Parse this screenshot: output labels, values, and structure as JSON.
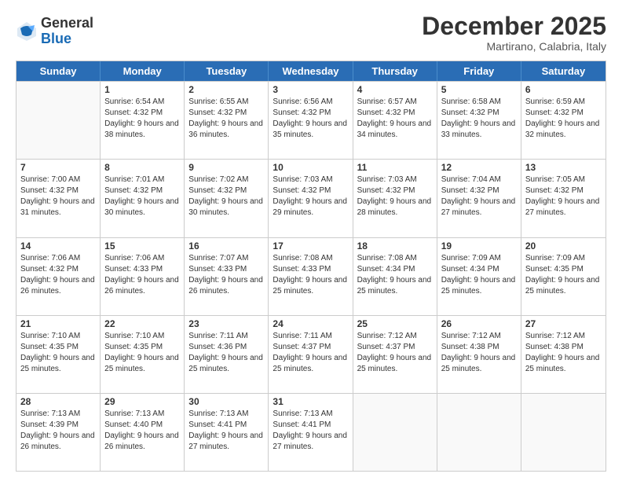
{
  "logo": {
    "general": "General",
    "blue": "Blue"
  },
  "header": {
    "title": "December 2025",
    "location": "Martirano, Calabria, Italy"
  },
  "days_of_week": [
    "Sunday",
    "Monday",
    "Tuesday",
    "Wednesday",
    "Thursday",
    "Friday",
    "Saturday"
  ],
  "weeks": [
    [
      {
        "day": "",
        "empty": true
      },
      {
        "day": "1",
        "sunrise": "Sunrise: 6:54 AM",
        "sunset": "Sunset: 4:32 PM",
        "daylight": "Daylight: 9 hours and 38 minutes."
      },
      {
        "day": "2",
        "sunrise": "Sunrise: 6:55 AM",
        "sunset": "Sunset: 4:32 PM",
        "daylight": "Daylight: 9 hours and 36 minutes."
      },
      {
        "day": "3",
        "sunrise": "Sunrise: 6:56 AM",
        "sunset": "Sunset: 4:32 PM",
        "daylight": "Daylight: 9 hours and 35 minutes."
      },
      {
        "day": "4",
        "sunrise": "Sunrise: 6:57 AM",
        "sunset": "Sunset: 4:32 PM",
        "daylight": "Daylight: 9 hours and 34 minutes."
      },
      {
        "day": "5",
        "sunrise": "Sunrise: 6:58 AM",
        "sunset": "Sunset: 4:32 PM",
        "daylight": "Daylight: 9 hours and 33 minutes."
      },
      {
        "day": "6",
        "sunrise": "Sunrise: 6:59 AM",
        "sunset": "Sunset: 4:32 PM",
        "daylight": "Daylight: 9 hours and 32 minutes."
      }
    ],
    [
      {
        "day": "7",
        "sunrise": "Sunrise: 7:00 AM",
        "sunset": "Sunset: 4:32 PM",
        "daylight": "Daylight: 9 hours and 31 minutes."
      },
      {
        "day": "8",
        "sunrise": "Sunrise: 7:01 AM",
        "sunset": "Sunset: 4:32 PM",
        "daylight": "Daylight: 9 hours and 30 minutes."
      },
      {
        "day": "9",
        "sunrise": "Sunrise: 7:02 AM",
        "sunset": "Sunset: 4:32 PM",
        "daylight": "Daylight: 9 hours and 30 minutes."
      },
      {
        "day": "10",
        "sunrise": "Sunrise: 7:03 AM",
        "sunset": "Sunset: 4:32 PM",
        "daylight": "Daylight: 9 hours and 29 minutes."
      },
      {
        "day": "11",
        "sunrise": "Sunrise: 7:03 AM",
        "sunset": "Sunset: 4:32 PM",
        "daylight": "Daylight: 9 hours and 28 minutes."
      },
      {
        "day": "12",
        "sunrise": "Sunrise: 7:04 AM",
        "sunset": "Sunset: 4:32 PM",
        "daylight": "Daylight: 9 hours and 27 minutes."
      },
      {
        "day": "13",
        "sunrise": "Sunrise: 7:05 AM",
        "sunset": "Sunset: 4:32 PM",
        "daylight": "Daylight: 9 hours and 27 minutes."
      }
    ],
    [
      {
        "day": "14",
        "sunrise": "Sunrise: 7:06 AM",
        "sunset": "Sunset: 4:32 PM",
        "daylight": "Daylight: 9 hours and 26 minutes."
      },
      {
        "day": "15",
        "sunrise": "Sunrise: 7:06 AM",
        "sunset": "Sunset: 4:33 PM",
        "daylight": "Daylight: 9 hours and 26 minutes."
      },
      {
        "day": "16",
        "sunrise": "Sunrise: 7:07 AM",
        "sunset": "Sunset: 4:33 PM",
        "daylight": "Daylight: 9 hours and 26 minutes."
      },
      {
        "day": "17",
        "sunrise": "Sunrise: 7:08 AM",
        "sunset": "Sunset: 4:33 PM",
        "daylight": "Daylight: 9 hours and 25 minutes."
      },
      {
        "day": "18",
        "sunrise": "Sunrise: 7:08 AM",
        "sunset": "Sunset: 4:34 PM",
        "daylight": "Daylight: 9 hours and 25 minutes."
      },
      {
        "day": "19",
        "sunrise": "Sunrise: 7:09 AM",
        "sunset": "Sunset: 4:34 PM",
        "daylight": "Daylight: 9 hours and 25 minutes."
      },
      {
        "day": "20",
        "sunrise": "Sunrise: 7:09 AM",
        "sunset": "Sunset: 4:35 PM",
        "daylight": "Daylight: 9 hours and 25 minutes."
      }
    ],
    [
      {
        "day": "21",
        "sunrise": "Sunrise: 7:10 AM",
        "sunset": "Sunset: 4:35 PM",
        "daylight": "Daylight: 9 hours and 25 minutes."
      },
      {
        "day": "22",
        "sunrise": "Sunrise: 7:10 AM",
        "sunset": "Sunset: 4:35 PM",
        "daylight": "Daylight: 9 hours and 25 minutes."
      },
      {
        "day": "23",
        "sunrise": "Sunrise: 7:11 AM",
        "sunset": "Sunset: 4:36 PM",
        "daylight": "Daylight: 9 hours and 25 minutes."
      },
      {
        "day": "24",
        "sunrise": "Sunrise: 7:11 AM",
        "sunset": "Sunset: 4:37 PM",
        "daylight": "Daylight: 9 hours and 25 minutes."
      },
      {
        "day": "25",
        "sunrise": "Sunrise: 7:12 AM",
        "sunset": "Sunset: 4:37 PM",
        "daylight": "Daylight: 9 hours and 25 minutes."
      },
      {
        "day": "26",
        "sunrise": "Sunrise: 7:12 AM",
        "sunset": "Sunset: 4:38 PM",
        "daylight": "Daylight: 9 hours and 25 minutes."
      },
      {
        "day": "27",
        "sunrise": "Sunrise: 7:12 AM",
        "sunset": "Sunset: 4:38 PM",
        "daylight": "Daylight: 9 hours and 25 minutes."
      }
    ],
    [
      {
        "day": "28",
        "sunrise": "Sunrise: 7:13 AM",
        "sunset": "Sunset: 4:39 PM",
        "daylight": "Daylight: 9 hours and 26 minutes."
      },
      {
        "day": "29",
        "sunrise": "Sunrise: 7:13 AM",
        "sunset": "Sunset: 4:40 PM",
        "daylight": "Daylight: 9 hours and 26 minutes."
      },
      {
        "day": "30",
        "sunrise": "Sunrise: 7:13 AM",
        "sunset": "Sunset: 4:41 PM",
        "daylight": "Daylight: 9 hours and 27 minutes."
      },
      {
        "day": "31",
        "sunrise": "Sunrise: 7:13 AM",
        "sunset": "Sunset: 4:41 PM",
        "daylight": "Daylight: 9 hours and 27 minutes."
      },
      {
        "day": "",
        "empty": true
      },
      {
        "day": "",
        "empty": true
      },
      {
        "day": "",
        "empty": true
      }
    ]
  ]
}
